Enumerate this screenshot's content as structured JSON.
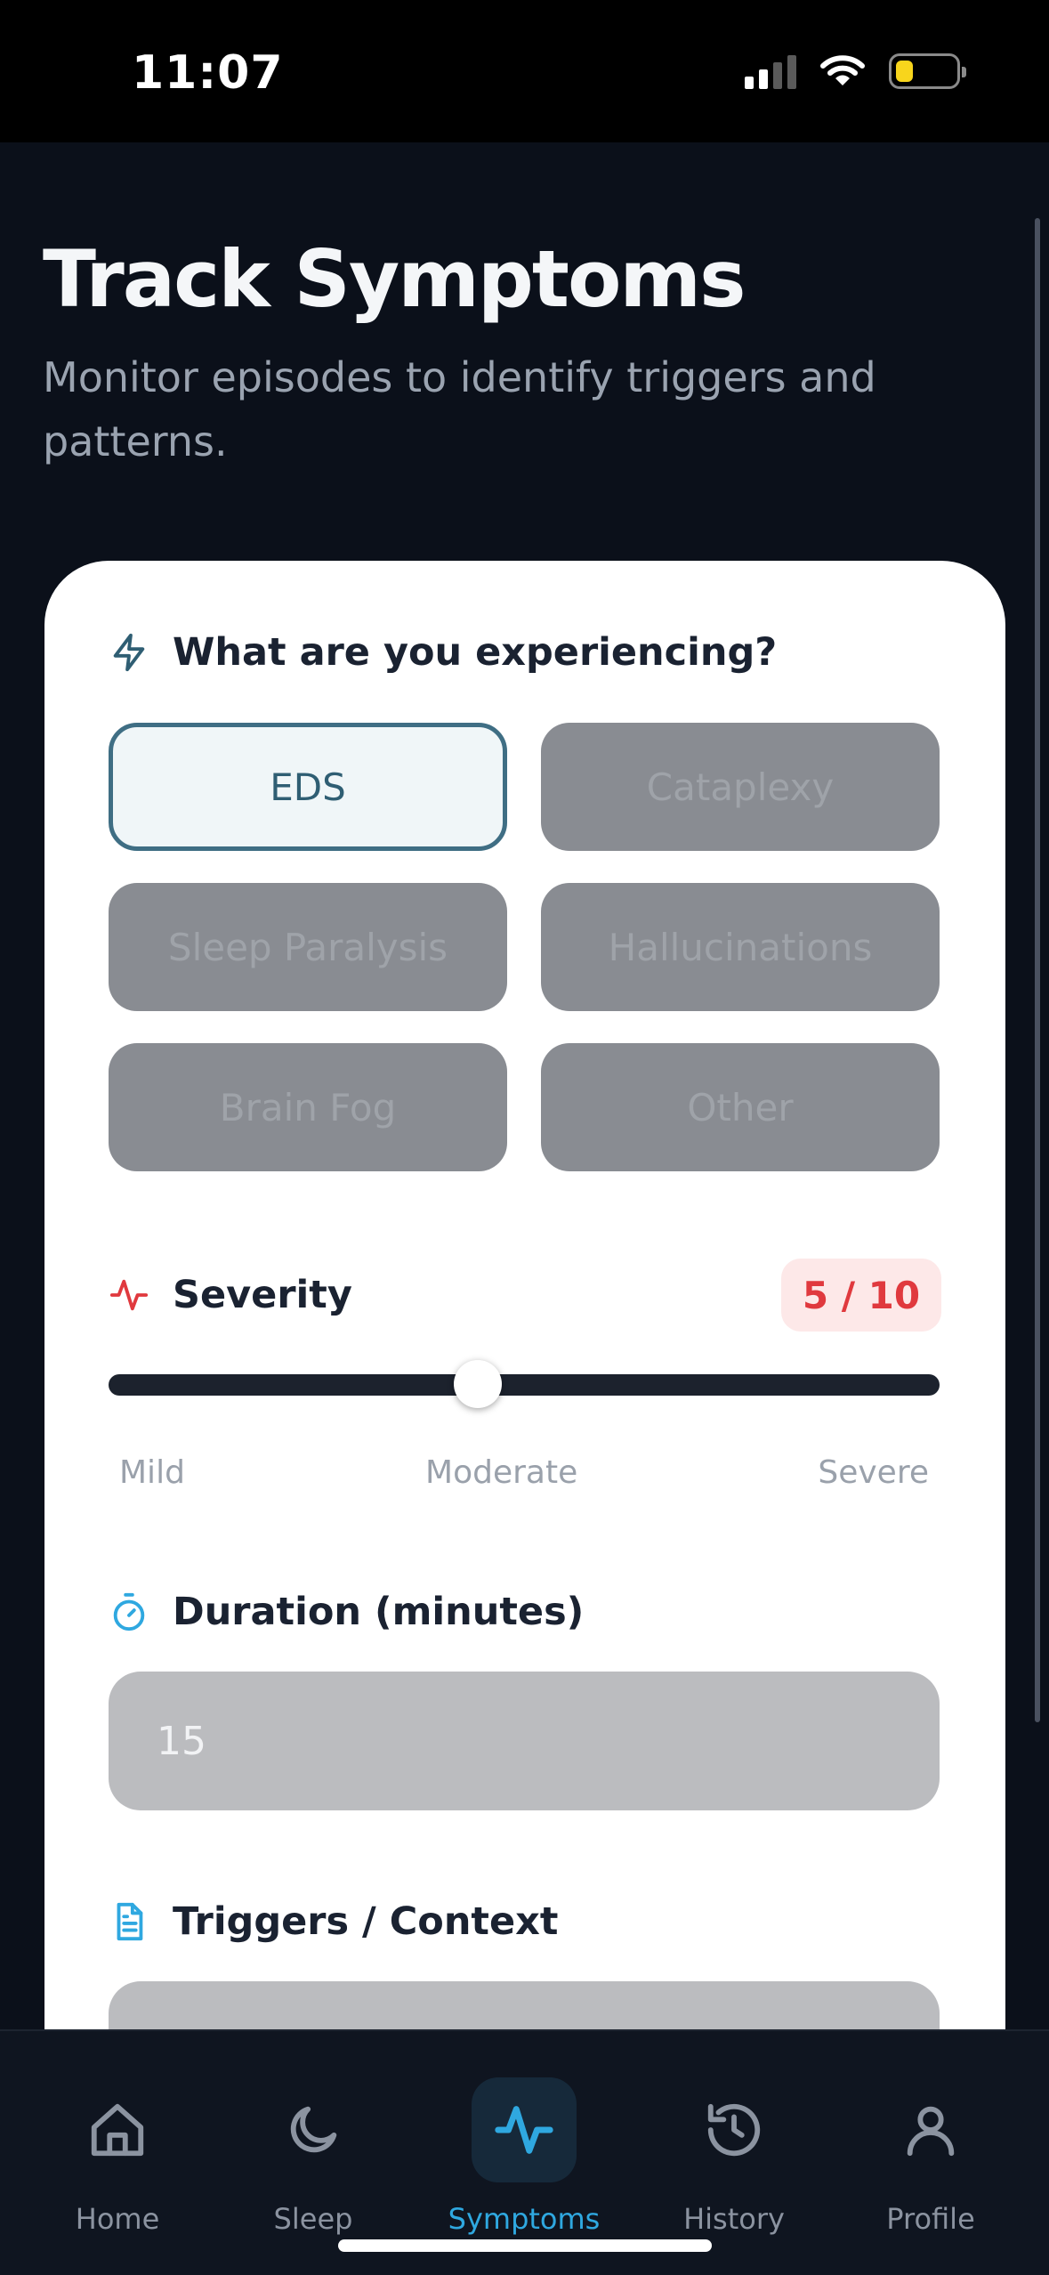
{
  "status_bar": {
    "time": "11:07",
    "battery_level": 0.3
  },
  "header": {
    "title": "Track Symptoms",
    "subtitle": "Monitor episodes to identify triggers and patterns."
  },
  "symptoms": {
    "label": "What are you experiencing?",
    "options": [
      {
        "label": "EDS",
        "selected": true
      },
      {
        "label": "Cataplexy",
        "selected": false
      },
      {
        "label": "Sleep Paralysis",
        "selected": false
      },
      {
        "label": "Hallucinations",
        "selected": false
      },
      {
        "label": "Brain Fog",
        "selected": false
      },
      {
        "label": "Other",
        "selected": false
      }
    ]
  },
  "severity": {
    "label": "Severity",
    "value": 5,
    "max": 10,
    "badge": "5 / 10",
    "scale_labels": [
      "Mild",
      "Moderate",
      "Severe"
    ]
  },
  "duration": {
    "label": "Duration (minutes)",
    "value": "15"
  },
  "triggers": {
    "label": "Triggers / Context"
  },
  "nav": {
    "items": [
      {
        "label": "Home",
        "icon": "home-icon",
        "active": false
      },
      {
        "label": "Sleep",
        "icon": "moon-icon",
        "active": false
      },
      {
        "label": "Symptoms",
        "icon": "activity-icon",
        "active": true
      },
      {
        "label": "History",
        "icon": "history-icon",
        "active": false
      },
      {
        "label": "Profile",
        "icon": "profile-icon",
        "active": false
      }
    ]
  },
  "colors": {
    "accent": "#2fa8e0",
    "selected_border": "#3f6e84",
    "severity_red": "#e0393e",
    "background": "#0b101a"
  }
}
